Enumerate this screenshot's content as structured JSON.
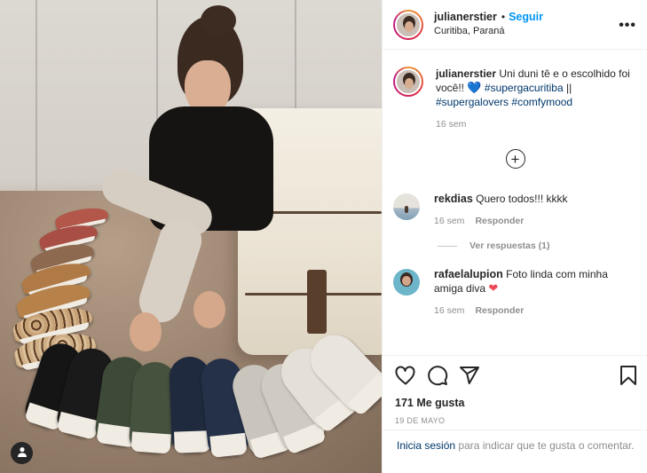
{
  "post": {
    "author": "julianerstier",
    "separator": "•",
    "follow_label": "Seguir",
    "location": "Curitiba, Paraná",
    "more_icon": "more-options-icon",
    "more_label": "•••"
  },
  "caption": {
    "author": "julianerstier",
    "text": "Uni duni tê e o escolhido foi você!!",
    "emoji": "💙",
    "hashtag1": "#supergacuritiba",
    "separator": "||",
    "hashtag2": "#supergalovers",
    "hashtag3": "#comfymood",
    "age": "16 sem"
  },
  "load_more": {
    "icon": "plus-circle-icon",
    "label": "+"
  },
  "comments": [
    {
      "author": "rekdias",
      "text": "Quero todos!!! kkkk",
      "age": "16 sem",
      "reply_label": "Responder",
      "view_replies": "Ver respuestas (1)"
    },
    {
      "author": "rafaelalupion",
      "text": "Foto linda com minha amiga diva",
      "emoji": "❤",
      "age": "16 sem",
      "reply_label": "Responder"
    }
  ],
  "actions": {
    "like_icon": "heart-icon",
    "comment_icon": "comment-icon",
    "share_icon": "send-icon",
    "save_icon": "bookmark-icon"
  },
  "likes_label": "171 Me gusta",
  "date_label": "19 DE MAYO",
  "login": {
    "link": "Inicia sesión",
    "rest": "para indicar que te gusta o comentar."
  },
  "colors": {
    "link_blue": "#0095f6",
    "hashtag": "#00376b",
    "muted": "#8e8e8e",
    "heart_red": "#ed4956",
    "heart_blue": "#3897f0"
  }
}
